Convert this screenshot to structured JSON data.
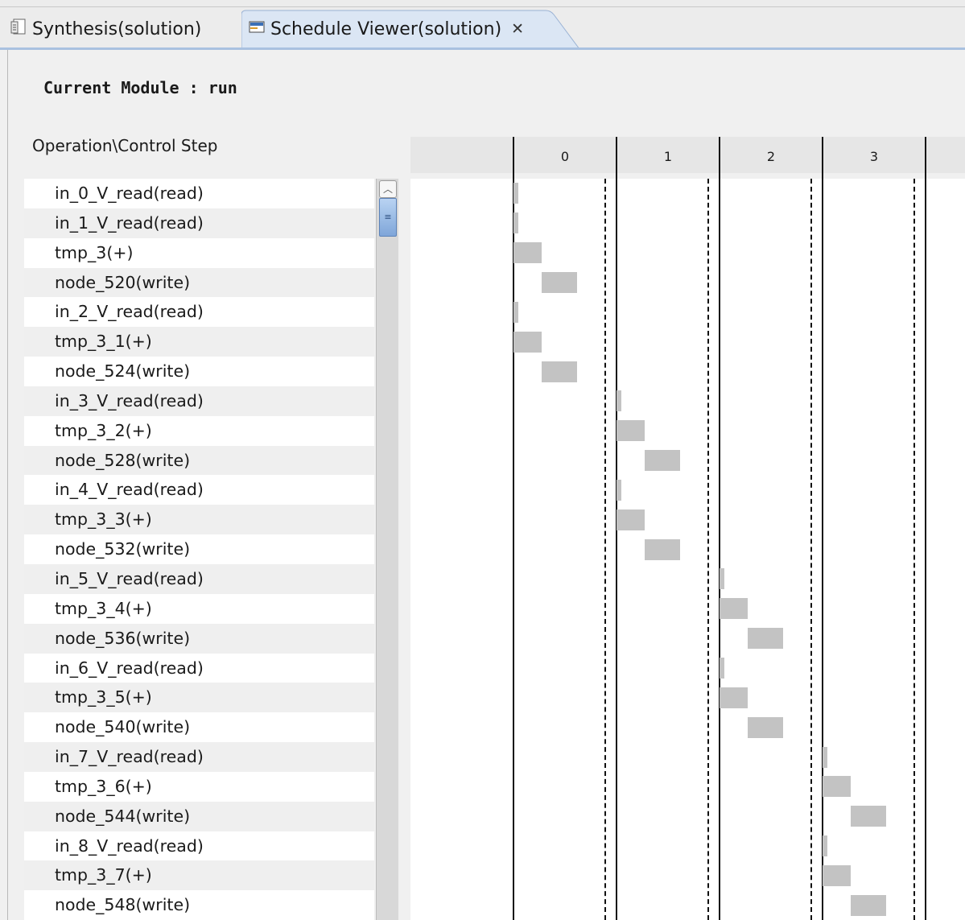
{
  "tabs": [
    {
      "label": "Synthesis(solution)",
      "icon": "document-icon",
      "active": false
    },
    {
      "label": "Schedule Viewer(solution)",
      "icon": "schedule-icon",
      "active": true,
      "close": "✕"
    }
  ],
  "module": {
    "label": "Current Module : run"
  },
  "table_header": "Operation\\Control Step",
  "control_steps": [
    "0",
    "1",
    "2",
    "3"
  ],
  "operations": [
    {
      "name": "in_0_V_read(read)",
      "step": 0,
      "start": 0.0,
      "dur": 0.05
    },
    {
      "name": "in_1_V_read(read)",
      "step": 0,
      "start": 0.0,
      "dur": 0.05
    },
    {
      "name": "tmp_3(+)",
      "step": 0,
      "start": 0.0,
      "dur": 0.27
    },
    {
      "name": "node_520(write)",
      "step": 0,
      "start": 0.27,
      "dur": 0.35
    },
    {
      "name": "in_2_V_read(read)",
      "step": 0,
      "start": 0.0,
      "dur": 0.05
    },
    {
      "name": "tmp_3_1(+)",
      "step": 0,
      "start": 0.0,
      "dur": 0.27
    },
    {
      "name": "node_524(write)",
      "step": 0,
      "start": 0.27,
      "dur": 0.35
    },
    {
      "name": "in_3_V_read(read)",
      "step": 1,
      "start": 0.0,
      "dur": 0.05
    },
    {
      "name": "tmp_3_2(+)",
      "step": 1,
      "start": 0.0,
      "dur": 0.27
    },
    {
      "name": "node_528(write)",
      "step": 1,
      "start": 0.27,
      "dur": 0.35
    },
    {
      "name": "in_4_V_read(read)",
      "step": 1,
      "start": 0.0,
      "dur": 0.05
    },
    {
      "name": "tmp_3_3(+)",
      "step": 1,
      "start": 0.0,
      "dur": 0.27
    },
    {
      "name": "node_532(write)",
      "step": 1,
      "start": 0.27,
      "dur": 0.35
    },
    {
      "name": "in_5_V_read(read)",
      "step": 2,
      "start": 0.0,
      "dur": 0.05
    },
    {
      "name": "tmp_3_4(+)",
      "step": 2,
      "start": 0.0,
      "dur": 0.27
    },
    {
      "name": "node_536(write)",
      "step": 2,
      "start": 0.27,
      "dur": 0.35
    },
    {
      "name": "in_6_V_read(read)",
      "step": 2,
      "start": 0.0,
      "dur": 0.05
    },
    {
      "name": "tmp_3_5(+)",
      "step": 2,
      "start": 0.0,
      "dur": 0.27
    },
    {
      "name": "node_540(write)",
      "step": 2,
      "start": 0.27,
      "dur": 0.35
    },
    {
      "name": "in_7_V_read(read)",
      "step": 3,
      "start": 0.0,
      "dur": 0.05
    },
    {
      "name": "tmp_3_6(+)",
      "step": 3,
      "start": 0.0,
      "dur": 0.27
    },
    {
      "name": "node_544(write)",
      "step": 3,
      "start": 0.27,
      "dur": 0.35
    },
    {
      "name": "in_8_V_read(read)",
      "step": 3,
      "start": 0.0,
      "dur": 0.05
    },
    {
      "name": "tmp_3_7(+)",
      "step": 3,
      "start": 0.0,
      "dur": 0.27
    },
    {
      "name": "node_548(write)",
      "step": 3,
      "start": 0.27,
      "dur": 0.35
    }
  ],
  "colors": {
    "bar": "#c3c3c3",
    "tab_active": "#dbe6f4",
    "scroll_thumb": "#9fbde6"
  }
}
